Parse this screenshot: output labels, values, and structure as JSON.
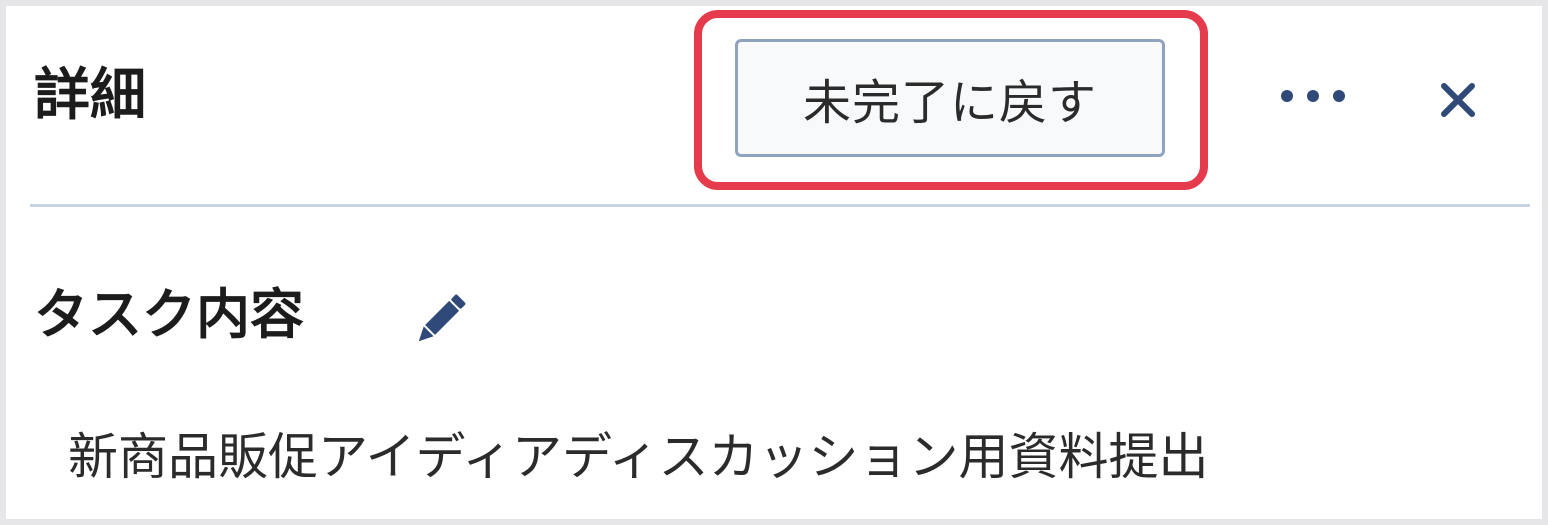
{
  "header": {
    "title": "詳細",
    "revert_button_label": "未完了に戻す",
    "more_icon": "more-horizontal-icon",
    "close_icon": "close-icon"
  },
  "section": {
    "title": "タスク内容",
    "edit_icon": "pencil-icon",
    "content": "新商品販促アイディアディスカッション用資料提出"
  },
  "colors": {
    "highlight": "#e63a4d",
    "accent": "#2f4a78",
    "button_border": "#8fa3bf",
    "divider": "#c9d3e2"
  }
}
